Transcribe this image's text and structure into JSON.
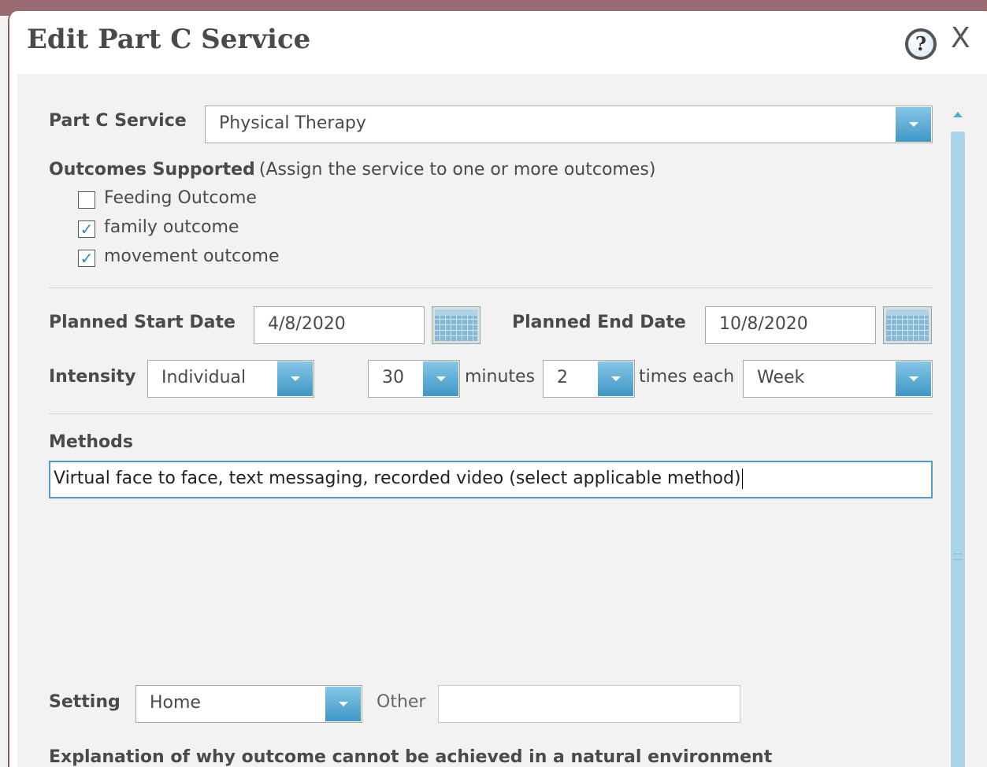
{
  "dialog": {
    "title": "Edit Part C Service",
    "close_label": "X",
    "help_label": "?"
  },
  "form": {
    "service": {
      "label": "Part C Service",
      "value": "Physical Therapy"
    },
    "outcomes": {
      "label": "Outcomes Supported",
      "hint": "(Assign the service to one or more outcomes)",
      "items": [
        {
          "label": "Feeding Outcome",
          "checked": false,
          "mark": ""
        },
        {
          "label": "family outcome",
          "checked": true,
          "mark": "✓"
        },
        {
          "label": "movement outcome",
          "checked": true,
          "mark": "✓"
        }
      ]
    },
    "start_date": {
      "label": "Planned Start Date",
      "value": "4/8/2020"
    },
    "end_date": {
      "label": "Planned End Date",
      "value": "10/8/2020"
    },
    "intensity": {
      "label": "Intensity",
      "type_value": "Individual",
      "minutes_value": "30",
      "minutes_label": "minutes",
      "times_value": "2",
      "times_label": "times each",
      "period_value": "Week"
    },
    "methods": {
      "label": "Methods",
      "value": "Virtual face to face, text messaging, recorded video (select applicable method)"
    },
    "setting": {
      "label": "Setting",
      "value": "Home",
      "other_label": "Other",
      "other_value": ""
    },
    "explanation": {
      "label": "Explanation of why outcome cannot be achieved in a natural environment"
    }
  },
  "colors": {
    "accent": "#3e97c5",
    "header_bar": "#9a6a72",
    "checkmark": "#2a8ac8"
  }
}
